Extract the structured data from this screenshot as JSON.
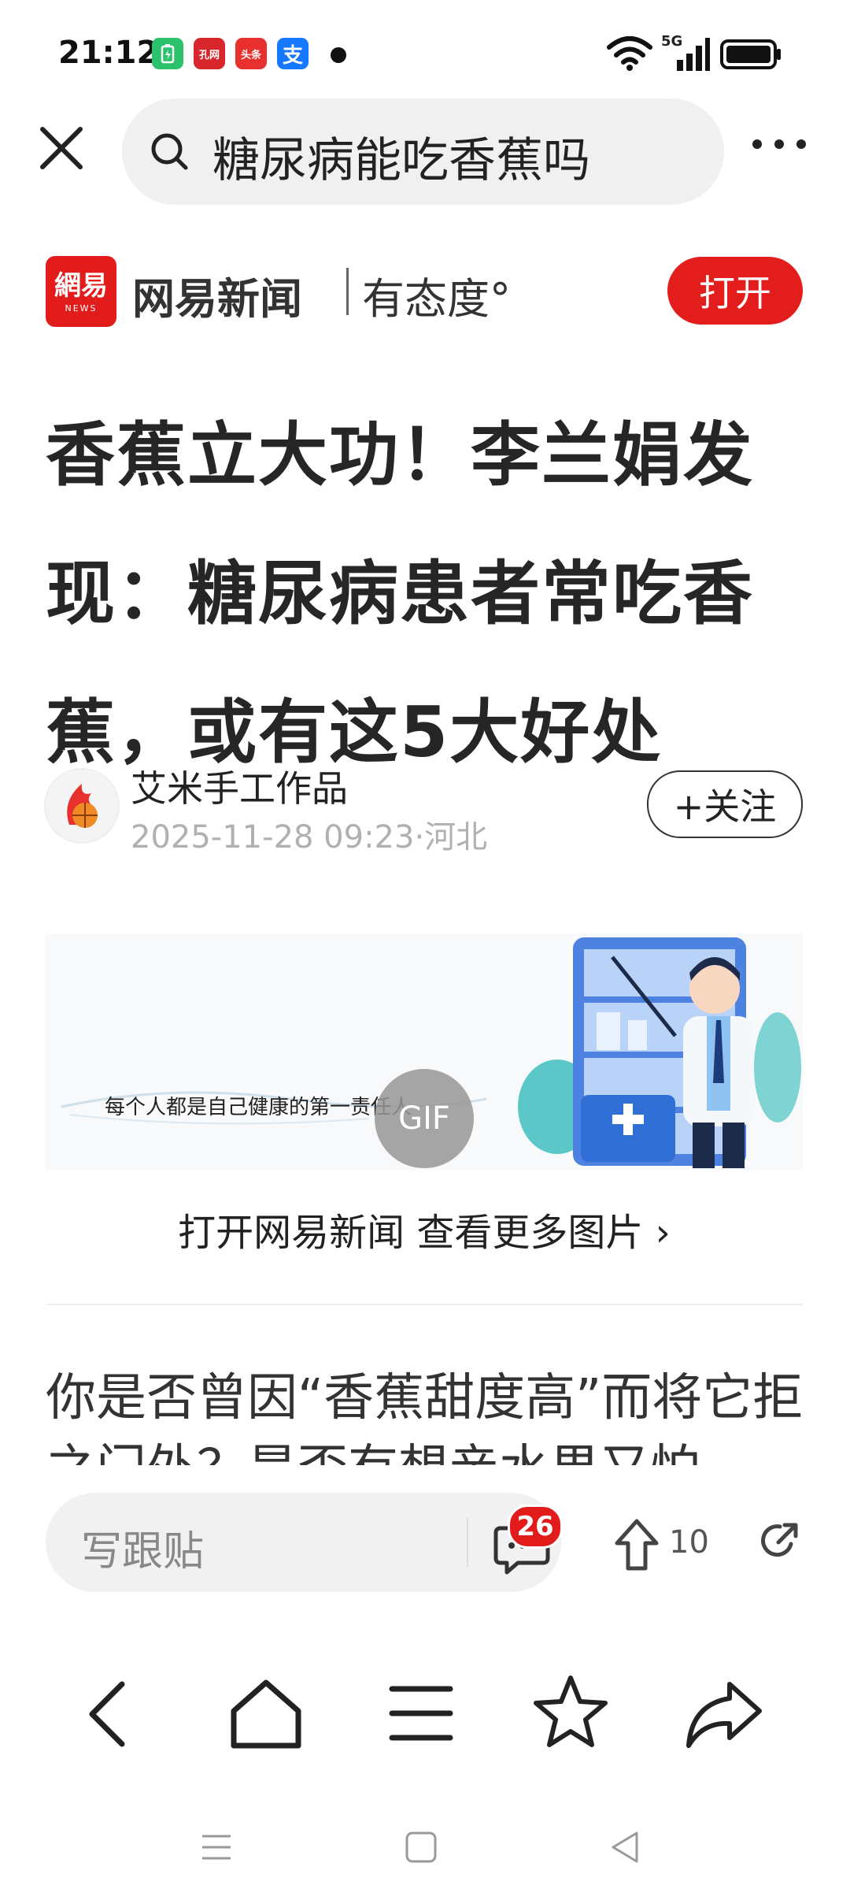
{
  "status_bar": {
    "time": "21:12",
    "apps": [
      {
        "name": "battery-app",
        "color": "#2bc26b",
        "glyph": "▮"
      },
      {
        "name": "kongwang-app",
        "color": "#d7262c",
        "glyph": "孔网"
      },
      {
        "name": "toutiao-app",
        "color": "#e8302f",
        "glyph": "头条"
      },
      {
        "name": "alipay-app",
        "color": "#1677ff",
        "glyph": "支"
      }
    ],
    "network": "5G"
  },
  "search": {
    "query": "糖尿病能吃香蕉吗"
  },
  "brand": {
    "logo_text": "網易",
    "logo_sub": "NEWS",
    "name": "网易新闻",
    "slogan": "有态度°",
    "open_label": "打开",
    "accent": "#e31c1c"
  },
  "article": {
    "headline": "香蕉立大功！李兰娟发现：糖尿病患者常吃香蕉，或有这5大好处",
    "author": "艾米手工作品",
    "meta": "2025-11-28 09:23·河北",
    "follow_label": "+关注",
    "image_caption": "每个人都是自己健康的第一责任人",
    "gif_label": "GIF",
    "more_pictures": "打开网易新闻 查看更多图片 ›",
    "body": "你是否曾因“香蕉甜度高”而将它拒之门外？是否有想亲水果又怕..."
  },
  "comment_bar": {
    "reply_placeholder": "写跟贴",
    "comment_count": "26",
    "like_count": "10"
  }
}
